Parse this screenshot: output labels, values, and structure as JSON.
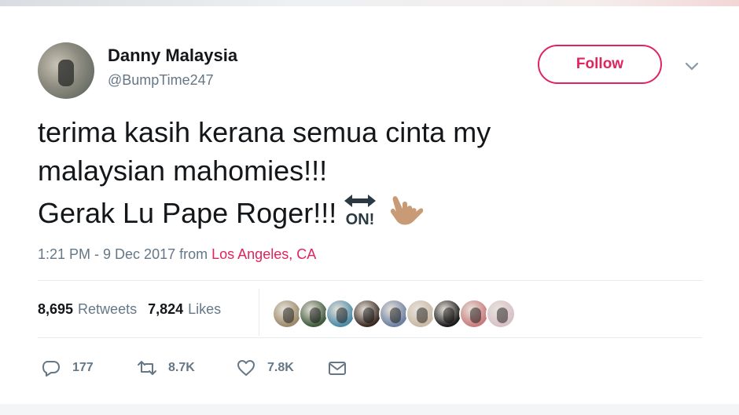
{
  "user": {
    "display_name": "Danny Malaysia",
    "handle": "@BumpTime247",
    "follow_label": "Follow"
  },
  "tweet": {
    "lines": [
      "terima kasih kerana semua cinta my",
      "malaysian mahomies!!!",
      "Gerak Lu Pape Roger!!!"
    ],
    "emojis": [
      "on-arrow-emoji",
      "call-me-hand-emoji"
    ],
    "emoji_on_text": "ON!",
    "timestamp": "1:21 PM - 9 Dec 2017",
    "from_label": "from",
    "location": "Los Angeles, CA"
  },
  "stats": {
    "retweets_count": "8,695",
    "retweets_label": "Retweets",
    "likes_count": "7,824",
    "likes_label": "Likes"
  },
  "likers": [
    {
      "name": "liker-avatar",
      "color": "#9b8a6a"
    },
    {
      "name": "liker-avatar",
      "color": "#3f5a3c"
    },
    {
      "name": "liker-avatar",
      "color": "#4b8aa6"
    },
    {
      "name": "liker-avatar",
      "color": "#3a2a22"
    },
    {
      "name": "liker-avatar",
      "color": "#6c7fa0"
    },
    {
      "name": "liker-avatar",
      "color": "#c9b9a6"
    },
    {
      "name": "liker-avatar",
      "color": "#1a1a1a"
    },
    {
      "name": "liker-avatar",
      "color": "#c77b7b"
    },
    {
      "name": "liker-avatar",
      "color": "#d8c1c8"
    }
  ],
  "actions": {
    "reply_count": "177",
    "retweet_count": "8.7K",
    "like_count": "7.8K"
  },
  "colors": {
    "accent": "#e0245e",
    "muted": "#657786",
    "text": "#14171a"
  }
}
